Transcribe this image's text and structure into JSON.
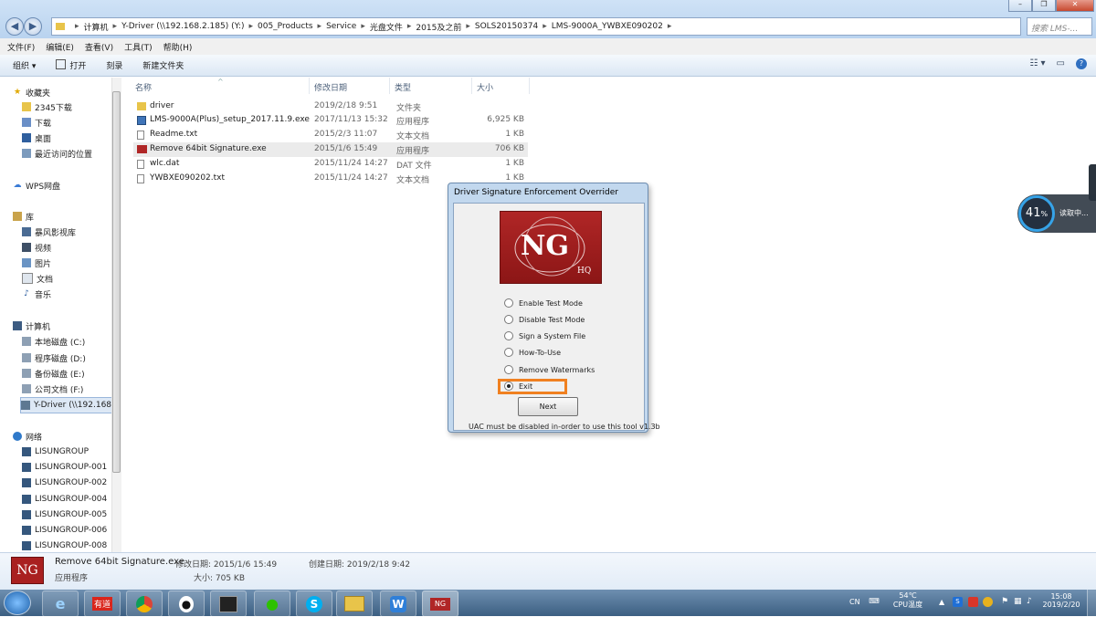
{
  "window": {
    "address_segments": [
      "计算机",
      "Y-Driver (\\\\192.168.2.185) (Y:)",
      "005_Products",
      "Service",
      "光盘文件",
      "2015及之前",
      "SOLS20150374",
      "LMS-9000A_YWBXE090202"
    ],
    "search_placeholder": "搜索 LMS-..."
  },
  "menu": [
    "文件(F)",
    "编辑(E)",
    "查看(V)",
    "工具(T)",
    "帮助(H)"
  ],
  "toolbar": {
    "organize": "组织 ▾",
    "open": "打开",
    "burn": "刻录",
    "new_folder": "新建文件夹"
  },
  "nav": {
    "favorites_header": "收藏夹",
    "favorites": [
      "2345下载",
      "下载",
      "桌面",
      "最近访问的位置"
    ],
    "wps": "WPS网盘",
    "library_header": "库",
    "libraries": [
      "暴风影视库",
      "视频",
      "图片",
      "文档",
      "音乐"
    ],
    "computer_header": "计算机",
    "drives": [
      "本地磁盘 (C:)",
      "程序磁盘 (D:)",
      "备份磁盘 (E:)",
      "公司文档 (F:)",
      "Y-Driver (\\\\192.168"
    ],
    "network_header": "网络",
    "network": [
      "LISUNGROUP",
      "LISUNGROUP-001",
      "LISUNGROUP-002",
      "LISUNGROUP-004",
      "LISUNGROUP-005",
      "LISUNGROUP-006",
      "LISUNGROUP-008"
    ]
  },
  "columns": {
    "name": "名称",
    "date": "修改日期",
    "type": "类型",
    "size": "大小"
  },
  "files": [
    {
      "name": "driver",
      "date": "2019/2/18 9:51",
      "type": "文件夹",
      "size": "",
      "icon": "folder-icon"
    },
    {
      "name": "LMS-9000A(Plus)_setup_2017.11.9.exe",
      "date": "2017/11/13 15:32",
      "type": "应用程序",
      "size": "6,925 KB",
      "icon": "setup-icon"
    },
    {
      "name": "Readme.txt",
      "date": "2015/2/3 11:07",
      "type": "文本文档",
      "size": "1 KB",
      "icon": "text-file-icon"
    },
    {
      "name": "Remove 64bit Signature.exe",
      "date": "2015/1/6 15:49",
      "type": "应用程序",
      "size": "706 KB",
      "icon": "ng-app-icon"
    },
    {
      "name": "wlc.dat",
      "date": "2015/11/24 14:27",
      "type": "DAT 文件",
      "size": "1 KB",
      "icon": "file-icon"
    },
    {
      "name": "YWBXE090202.txt",
      "date": "2015/11/24 14:27",
      "type": "文本文档",
      "size": "1 KB",
      "icon": "text-file-icon"
    }
  ],
  "details": {
    "name": "Remove 64bit Signature.exe",
    "modified": "修改日期: 2015/1/6 15:49",
    "created": "创建日期: 2019/2/18 9:42",
    "type": "应用程序",
    "size": "大小: 705 KB",
    "thumb_text": "NG"
  },
  "dialog": {
    "title": "Driver Signature Enforcement Overrider",
    "logo_text": "NG",
    "logo_sub": "HQ",
    "options": [
      "Enable Test Mode",
      "Disable Test Mode",
      "Sign a System File",
      "How-To-Use",
      "Remove Watermarks",
      "Exit"
    ],
    "selected_option": "Exit",
    "next": "Next",
    "note": "UAC must be disabled in-order to use this tool     v1.3b"
  },
  "overlay": {
    "percent": "41",
    "percent_unit": "%",
    "label": "读取中..."
  },
  "taskbar": {
    "youdao": "有道",
    "tray_lang": "CN",
    "temp": "54℃",
    "temp_label": "CPU温度",
    "time": "15:08",
    "date": "2019/2/20"
  }
}
